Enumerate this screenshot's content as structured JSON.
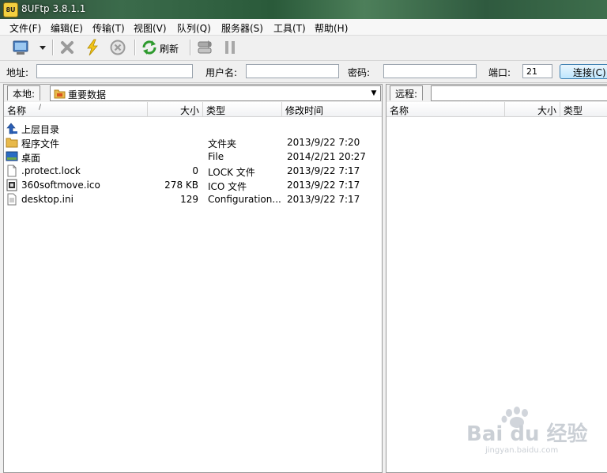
{
  "window": {
    "title": "8UFtp 3.8.1.1",
    "app_icon_text": "8UFtp"
  },
  "menu": [
    "文件(F)",
    "编辑(E)",
    "传输(T)",
    "视图(V)",
    "队列(Q)",
    "服务器(S)",
    "工具(T)",
    "帮助(H)"
  ],
  "toolbar": {
    "refresh_label": "刷新"
  },
  "connection": {
    "address_label": "地址:",
    "address_value": "",
    "username_label": "用户名:",
    "username_value": "",
    "password_label": "密码:",
    "password_value": "",
    "port_label": "端口:",
    "port_value": "21",
    "connect_label": "连接(C)"
  },
  "local": {
    "tab_label": "本地:",
    "path": "重要数据",
    "columns": [
      "名称",
      "大小",
      "类型",
      "修改时间"
    ],
    "sort_indicator": "/",
    "rows": [
      {
        "icon": "up-arrow-icon",
        "name": "上层目录",
        "size": "",
        "type": "",
        "modified": ""
      },
      {
        "icon": "folder-icon",
        "name": "程序文件",
        "size": "",
        "type": "文件夹",
        "modified": "2013/9/22 7:20"
      },
      {
        "icon": "desktop-icon",
        "name": "桌面",
        "size": "",
        "type": "File",
        "modified": "2014/2/21 20:27"
      },
      {
        "icon": "file-icon",
        "name": ".protect.lock",
        "size": "0",
        "type": "LOCK 文件",
        "modified": "2013/9/22 7:17"
      },
      {
        "icon": "ico-file-icon",
        "name": "360softmove.ico",
        "size": "278 KB",
        "type": "ICO 文件",
        "modified": "2013/9/22 7:17"
      },
      {
        "icon": "ini-file-icon",
        "name": "desktop.ini",
        "size": "129",
        "type": "Configuration...",
        "modified": "2013/9/22 7:17"
      }
    ]
  },
  "remote": {
    "tab_label": "远程:",
    "columns": [
      "名称",
      "大小",
      "类型"
    ]
  },
  "watermark": {
    "brand": "Bai du 经验",
    "url": "jingyan.baidu.com"
  }
}
